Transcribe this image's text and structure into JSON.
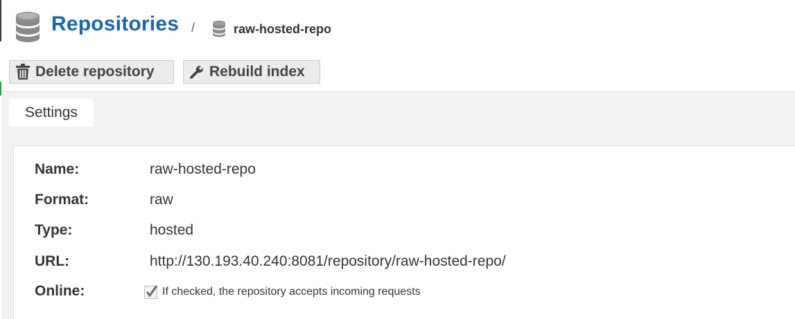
{
  "header": {
    "title": "Repositories",
    "separator": "/",
    "current_repo": "raw-hosted-repo"
  },
  "toolbar": {
    "delete_label": "Delete repository",
    "rebuild_label": "Rebuild index"
  },
  "tabs": [
    {
      "label": "Settings",
      "active": true
    }
  ],
  "settings": {
    "fields": [
      {
        "label": "Name:",
        "value": "raw-hosted-repo"
      },
      {
        "label": "Format:",
        "value": "raw"
      },
      {
        "label": "Type:",
        "value": "hosted"
      },
      {
        "label": "URL:",
        "value": "http://130.193.40.240:8081/repository/raw-hosted-repo/"
      }
    ],
    "online": {
      "label": "Online:",
      "checked": true,
      "help_text": "If checked, the repository accepts incoming requests"
    }
  },
  "icons": {
    "header": "database-icon",
    "breadcrumb": "database-icon",
    "delete": "trash-icon",
    "rebuild": "wrench-icon",
    "checkbox": "checkmark-icon"
  },
  "colors": {
    "title_blue": "#1567b0",
    "panel_bg": "#f2f2f2",
    "button_bg": "#ececec"
  }
}
